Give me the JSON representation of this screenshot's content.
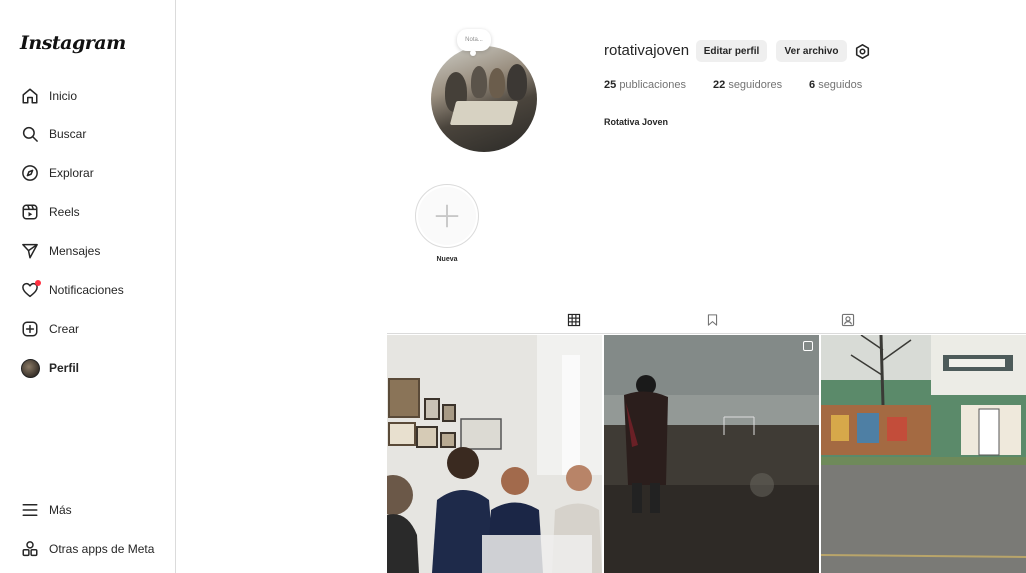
{
  "sidebar": {
    "logo": "Instagram",
    "items": [
      {
        "label": "Inicio",
        "icon": "home-icon"
      },
      {
        "label": "Buscar",
        "icon": "search-icon"
      },
      {
        "label": "Explorar",
        "icon": "compass-icon"
      },
      {
        "label": "Reels",
        "icon": "reels-icon"
      },
      {
        "label": "Mensajes",
        "icon": "send-icon"
      },
      {
        "label": "Notificaciones",
        "icon": "heart-icon"
      },
      {
        "label": "Crear",
        "icon": "plus-square-icon"
      },
      {
        "label": "Perfil",
        "icon": "avatar"
      }
    ],
    "bottom": [
      {
        "label": "Más",
        "icon": "menu-icon"
      },
      {
        "label": "Otras apps de Meta",
        "icon": "apps-icon"
      }
    ]
  },
  "profile": {
    "note": "Nota...",
    "username": "rotativajoven",
    "edit_label": "Editar perfil",
    "archive_label": "Ver archivo",
    "stats": [
      {
        "count": "25",
        "label": "publicaciones"
      },
      {
        "count": "22",
        "label": "seguidores"
      },
      {
        "count": "6",
        "label": "seguidos"
      }
    ],
    "full_name": "Rotativa Joven"
  },
  "highlights": {
    "new_label": "Nueva"
  },
  "tabs": [
    {
      "icon": "grid-icon",
      "active": true
    },
    {
      "icon": "bookmark-icon",
      "active": false
    },
    {
      "icon": "tagged-icon",
      "active": false
    }
  ],
  "colors": {
    "notification_dot": "#ff3040",
    "button_bg": "#efefef",
    "border": "#dbdbdb"
  }
}
